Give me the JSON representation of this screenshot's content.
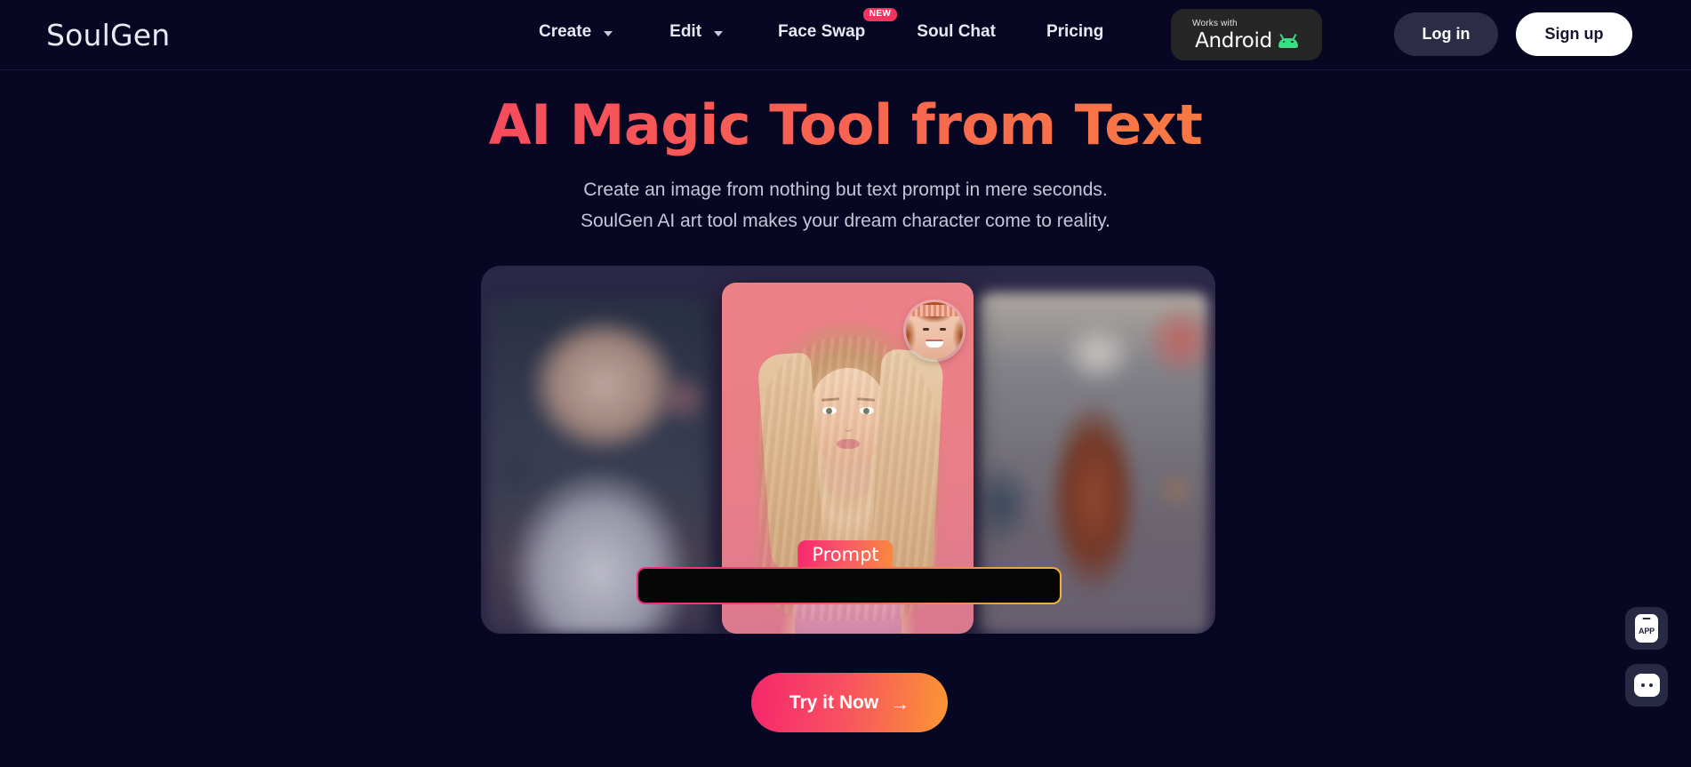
{
  "brand": {
    "name": "SoulGen"
  },
  "nav": {
    "items": [
      {
        "label": "Create",
        "has_dropdown": true,
        "icon": "chevron-down-icon"
      },
      {
        "label": "Edit",
        "has_dropdown": true,
        "icon": "chevron-down-icon"
      },
      {
        "label": "Face Swap",
        "has_dropdown": false,
        "badge": "NEW"
      },
      {
        "label": "Soul Chat",
        "has_dropdown": false
      },
      {
        "label": "Pricing",
        "has_dropdown": false
      }
    ]
  },
  "android_badge": {
    "works_with": "Works with",
    "platform": "Android",
    "icon": "android-robot-icon"
  },
  "auth": {
    "login_label": "Log in",
    "signup_label": "Sign up"
  },
  "hero": {
    "title": "AI Magic Tool from Text",
    "subtitle_line_1": "Create an image from nothing but text prompt in mere seconds.",
    "subtitle_line_2": "SoulGen AI art tool makes your dream character come to reality."
  },
  "prompt": {
    "badge_label": "Prompt",
    "value": "",
    "placeholder": ""
  },
  "cta": {
    "label": "Try it Now",
    "arrow": "→"
  },
  "floating": [
    {
      "name": "app-widget",
      "label": "APP",
      "icon": "phone-app-icon"
    },
    {
      "name": "chat-widget",
      "label": "",
      "icon": "chat-dots-icon"
    }
  ],
  "colors": {
    "background": "#070724",
    "accent_pink": "#f6276c",
    "accent_orange": "#fa9634",
    "badge_new": "#f6325f",
    "carousel_bg": "#2b2747",
    "android_bg": "#262626",
    "android_green": "#3ddc84",
    "login_bg": "#2c2c46",
    "signup_bg": "#ffffff"
  }
}
